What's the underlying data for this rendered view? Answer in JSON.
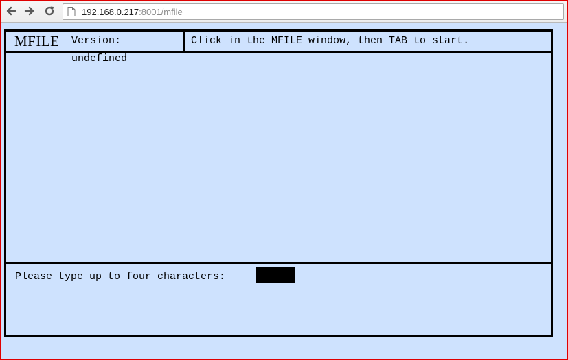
{
  "browser": {
    "back_icon": "arrow-left-icon",
    "forward_icon": "arrow-right-icon",
    "reload_icon": "reload-icon",
    "page_icon": "page-icon",
    "url_host": "192.168.0.217",
    "url_rest": ":8001/mfile"
  },
  "mfile": {
    "logo": "MFILE",
    "version_label": "Version:",
    "version_value": "undefined",
    "instruction": "Click in the MFILE window, then TAB to start.",
    "prompt": "Please type up to four characters:",
    "input_value": ""
  },
  "colors": {
    "page_background": "#cee2fe",
    "border": "#000000",
    "input_background": "#000000",
    "window_frame": "#e00000"
  }
}
